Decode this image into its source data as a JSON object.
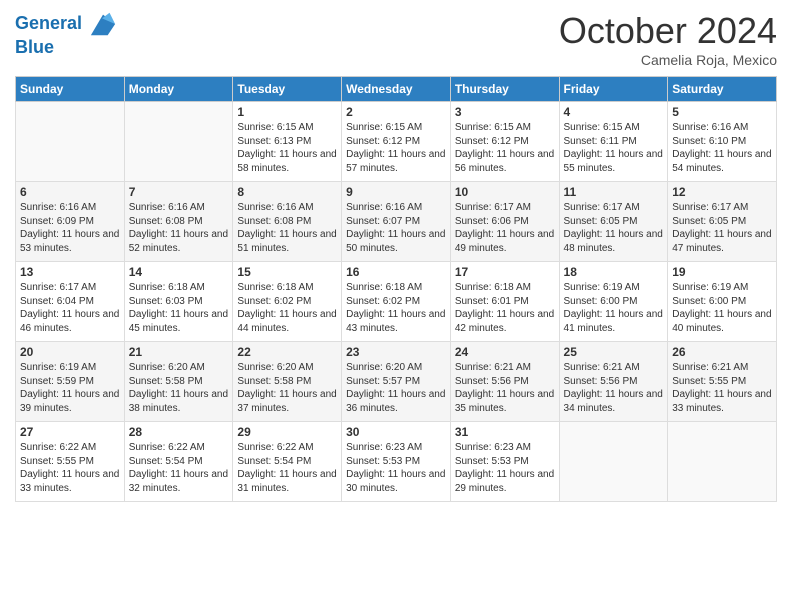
{
  "header": {
    "logo_line1": "General",
    "logo_line2": "Blue",
    "month": "October 2024",
    "location": "Camelia Roja, Mexico"
  },
  "weekdays": [
    "Sunday",
    "Monday",
    "Tuesday",
    "Wednesday",
    "Thursday",
    "Friday",
    "Saturday"
  ],
  "weeks": [
    [
      {
        "day": "",
        "info": ""
      },
      {
        "day": "",
        "info": ""
      },
      {
        "day": "1",
        "info": "Sunrise: 6:15 AM\nSunset: 6:13 PM\nDaylight: 11 hours and 58 minutes."
      },
      {
        "day": "2",
        "info": "Sunrise: 6:15 AM\nSunset: 6:12 PM\nDaylight: 11 hours and 57 minutes."
      },
      {
        "day": "3",
        "info": "Sunrise: 6:15 AM\nSunset: 6:12 PM\nDaylight: 11 hours and 56 minutes."
      },
      {
        "day": "4",
        "info": "Sunrise: 6:15 AM\nSunset: 6:11 PM\nDaylight: 11 hours and 55 minutes."
      },
      {
        "day": "5",
        "info": "Sunrise: 6:16 AM\nSunset: 6:10 PM\nDaylight: 11 hours and 54 minutes."
      }
    ],
    [
      {
        "day": "6",
        "info": "Sunrise: 6:16 AM\nSunset: 6:09 PM\nDaylight: 11 hours and 53 minutes."
      },
      {
        "day": "7",
        "info": "Sunrise: 6:16 AM\nSunset: 6:08 PM\nDaylight: 11 hours and 52 minutes."
      },
      {
        "day": "8",
        "info": "Sunrise: 6:16 AM\nSunset: 6:08 PM\nDaylight: 11 hours and 51 minutes."
      },
      {
        "day": "9",
        "info": "Sunrise: 6:16 AM\nSunset: 6:07 PM\nDaylight: 11 hours and 50 minutes."
      },
      {
        "day": "10",
        "info": "Sunrise: 6:17 AM\nSunset: 6:06 PM\nDaylight: 11 hours and 49 minutes."
      },
      {
        "day": "11",
        "info": "Sunrise: 6:17 AM\nSunset: 6:05 PM\nDaylight: 11 hours and 48 minutes."
      },
      {
        "day": "12",
        "info": "Sunrise: 6:17 AM\nSunset: 6:05 PM\nDaylight: 11 hours and 47 minutes."
      }
    ],
    [
      {
        "day": "13",
        "info": "Sunrise: 6:17 AM\nSunset: 6:04 PM\nDaylight: 11 hours and 46 minutes."
      },
      {
        "day": "14",
        "info": "Sunrise: 6:18 AM\nSunset: 6:03 PM\nDaylight: 11 hours and 45 minutes."
      },
      {
        "day": "15",
        "info": "Sunrise: 6:18 AM\nSunset: 6:02 PM\nDaylight: 11 hours and 44 minutes."
      },
      {
        "day": "16",
        "info": "Sunrise: 6:18 AM\nSunset: 6:02 PM\nDaylight: 11 hours and 43 minutes."
      },
      {
        "day": "17",
        "info": "Sunrise: 6:18 AM\nSunset: 6:01 PM\nDaylight: 11 hours and 42 minutes."
      },
      {
        "day": "18",
        "info": "Sunrise: 6:19 AM\nSunset: 6:00 PM\nDaylight: 11 hours and 41 minutes."
      },
      {
        "day": "19",
        "info": "Sunrise: 6:19 AM\nSunset: 6:00 PM\nDaylight: 11 hours and 40 minutes."
      }
    ],
    [
      {
        "day": "20",
        "info": "Sunrise: 6:19 AM\nSunset: 5:59 PM\nDaylight: 11 hours and 39 minutes."
      },
      {
        "day": "21",
        "info": "Sunrise: 6:20 AM\nSunset: 5:58 PM\nDaylight: 11 hours and 38 minutes."
      },
      {
        "day": "22",
        "info": "Sunrise: 6:20 AM\nSunset: 5:58 PM\nDaylight: 11 hours and 37 minutes."
      },
      {
        "day": "23",
        "info": "Sunrise: 6:20 AM\nSunset: 5:57 PM\nDaylight: 11 hours and 36 minutes."
      },
      {
        "day": "24",
        "info": "Sunrise: 6:21 AM\nSunset: 5:56 PM\nDaylight: 11 hours and 35 minutes."
      },
      {
        "day": "25",
        "info": "Sunrise: 6:21 AM\nSunset: 5:56 PM\nDaylight: 11 hours and 34 minutes."
      },
      {
        "day": "26",
        "info": "Sunrise: 6:21 AM\nSunset: 5:55 PM\nDaylight: 11 hours and 33 minutes."
      }
    ],
    [
      {
        "day": "27",
        "info": "Sunrise: 6:22 AM\nSunset: 5:55 PM\nDaylight: 11 hours and 33 minutes."
      },
      {
        "day": "28",
        "info": "Sunrise: 6:22 AM\nSunset: 5:54 PM\nDaylight: 11 hours and 32 minutes."
      },
      {
        "day": "29",
        "info": "Sunrise: 6:22 AM\nSunset: 5:54 PM\nDaylight: 11 hours and 31 minutes."
      },
      {
        "day": "30",
        "info": "Sunrise: 6:23 AM\nSunset: 5:53 PM\nDaylight: 11 hours and 30 minutes."
      },
      {
        "day": "31",
        "info": "Sunrise: 6:23 AM\nSunset: 5:53 PM\nDaylight: 11 hours and 29 minutes."
      },
      {
        "day": "",
        "info": ""
      },
      {
        "day": "",
        "info": ""
      }
    ]
  ]
}
